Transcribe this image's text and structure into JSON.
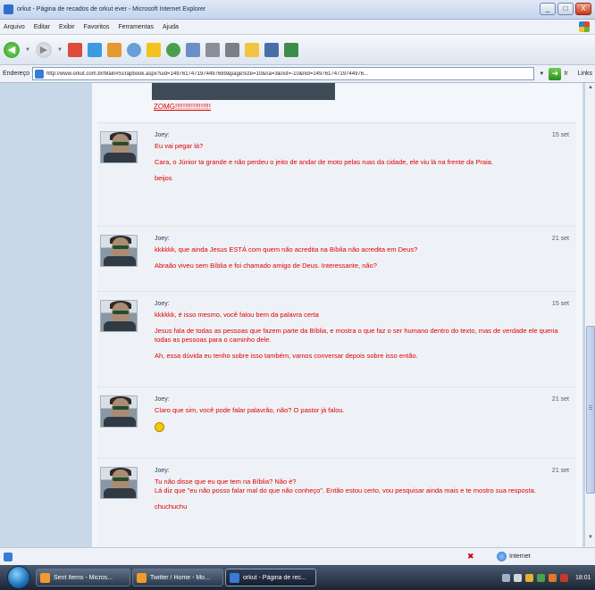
{
  "window": {
    "title": "orkut - Página de recados de orkut ever - Microsoft Internet Explorer",
    "controls": [
      "_",
      "□",
      "X"
    ]
  },
  "menubar": [
    "Arquivo",
    "Editar",
    "Exibir",
    "Favoritos",
    "Ferramentas",
    "Ajuda"
  ],
  "toolbar": {
    "back_glyph": "◀",
    "forward_glyph": "▶",
    "caret": "▼",
    "icons": [
      "stop-icon",
      "refresh-icon",
      "home-icon",
      "search-icon",
      "favorites-icon",
      "history-icon",
      "mail-icon",
      "print-icon",
      "edit-icon",
      "folder-icon",
      "tools-icon",
      "messenger-icon"
    ]
  },
  "addressbar": {
    "label": "Endereço",
    "url": "http://www.orkut.com.br/Main#Scrapbook.aspx?uid=1497617471974497689&pageSize=10&na=3&nst=-10&nid=14976174719744976...",
    "go_label": "Ir",
    "links_label": "Links"
  },
  "content": {
    "top_link": "ZOMG!!!!!!!!!!!!!!!!!!",
    "posts": [
      {
        "author": "Joey:",
        "time": "15 set",
        "paragraphs": [
          "Eu vai pegar lá?",
          "Cara, o Júnior ta grande e não perdeu o jeito de andar de moto pelas ruas da cidade, ele viu lá na frente da Praia.",
          "beijos"
        ]
      },
      {
        "author": "Joey:",
        "time": "21 set",
        "paragraphs": [
          "kkkkkk, que ainda Jesus ESTÁ com quem não acredita na Bíblia não acredita em Deus?",
          "Abraão viveu sem Bíblia e foi chamado amigo de Deus. Interessante, não?"
        ]
      },
      {
        "author": "Joey:",
        "time": "15 set",
        "paragraphs": [
          "kkkkkk, é isso mesmo, você falou bem da palavra certa",
          "Jesus fala de todas as pessoas que fazem parte da Bíblia, e mostra o que faz o ser humano dentro do texto, mas de verdade ele queria todas as pessoas para o caminho dele.",
          "Ah, essa dúvida eu tenho sobre isso também, vamos conversar depois sobre isso então."
        ]
      },
      {
        "author": "Joey:",
        "time": "21 set",
        "paragraphs": [
          "Claro que sim, você pode falar palavrão, não? O pastor já falou."
        ],
        "emoji": true
      },
      {
        "author": "Joey:",
        "time": "21 set",
        "paragraphs": [
          "Tu não disse que eu que tem na Bíblia? Não é?",
          "Lá diz que \"eu não posso falar mal do que não conheço\". Então estou certo, vou pesquisar ainda mais e te mostro sua resposta.",
          "chuchuchu"
        ]
      }
    ]
  },
  "statusbar": {
    "zone_label": "Internet"
  },
  "taskbar": {
    "tasks": [
      {
        "label": "Sent Items - Micros...",
        "active": false
      },
      {
        "label": "Twitter / Home - Mo...",
        "active": false
      },
      {
        "label": "orkut - Página de rec...",
        "active": true
      }
    ],
    "clock": "18:01"
  }
}
